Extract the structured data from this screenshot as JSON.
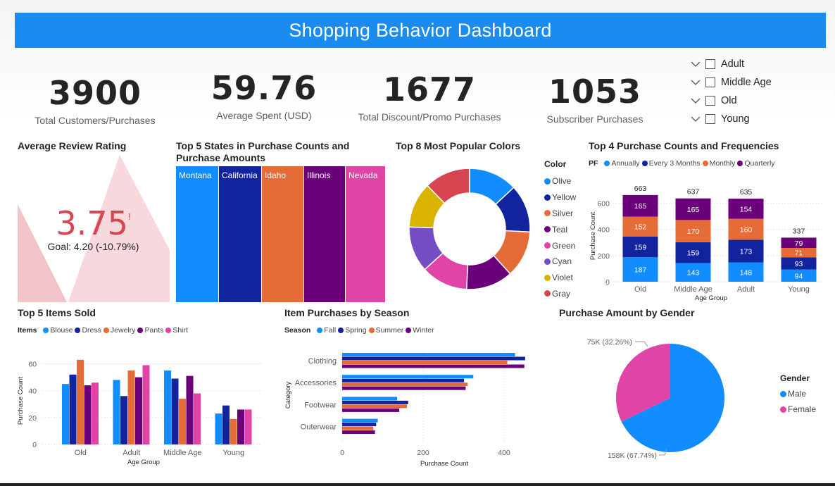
{
  "banner": {
    "title": "Shopping Behavior Dashboard"
  },
  "kpis": [
    {
      "value": "3900",
      "label": "Total Customers/Purchases"
    },
    {
      "value": "59.76",
      "label": "Average Spent (USD)"
    },
    {
      "value": "1677",
      "label": "Total Discount/Promo Purchases"
    },
    {
      "value": "1053",
      "label": "Subscriber Purchases"
    }
  ],
  "slicer": {
    "items": [
      "Adult",
      "Middle Age",
      "Old",
      "Young"
    ]
  },
  "rating": {
    "title": "Average Review Rating",
    "value": "3.75",
    "alert": "!",
    "goal": "Goal: 4.20 (-10.79%)"
  },
  "states": {
    "title_line1": "Top 5 States in Purchase Counts and",
    "title_line2": "Purchase Amounts",
    "items": [
      {
        "name": "Montana",
        "color": "#118dff"
      },
      {
        "name": "California",
        "color": "#12239e"
      },
      {
        "name": "Idaho",
        "color": "#e66c37"
      },
      {
        "name": "Illinois",
        "color": "#6b007b"
      },
      {
        "name": "Nevada",
        "color": "#e044a7"
      }
    ]
  },
  "colors_chart": {
    "title": "Top 8 Most Popular Colors",
    "legend_title": "Color",
    "items": [
      {
        "name": "Olive",
        "color": "#118dff",
        "share": 0.13
      },
      {
        "name": "Yellow",
        "color": "#12239e",
        "share": 0.128
      },
      {
        "name": "Silver",
        "color": "#e66c37",
        "share": 0.125
      },
      {
        "name": "Teal",
        "color": "#6b007b",
        "share": 0.125
      },
      {
        "name": "Green",
        "color": "#e044a7",
        "share": 0.125
      },
      {
        "name": "Cyan",
        "color": "#744ec2",
        "share": 0.122
      },
      {
        "name": "Violet",
        "color": "#d9b300",
        "share": 0.122
      },
      {
        "name": "Gray",
        "color": "#d64550",
        "share": 0.123
      }
    ]
  },
  "freq_chart": {
    "title": "Top 4 Purchase Counts and Frequencies",
    "legend_title": "PF",
    "ylabel": "Purchase Count",
    "xlabel": "Age Group",
    "yticks": [
      "0",
      "200",
      "400",
      "600"
    ]
  },
  "items_chart": {
    "title": "Top 5 Items Sold",
    "legend_title": "Items",
    "ylabel": "Purchase Count",
    "xlabel": "Age Group",
    "yticks": [
      "0",
      "20",
      "40",
      "60"
    ]
  },
  "season_chart": {
    "title": "Item Purchases by Season",
    "legend_title": "Season",
    "ylabel": "Category",
    "xlabel": "Purchase Count",
    "xticks": [
      "0",
      "200",
      "400"
    ]
  },
  "gender_chart": {
    "title": "Purchase Amount by Gender",
    "legend_title": "Gender",
    "items": [
      {
        "name": "Male",
        "color": "#118dff"
      },
      {
        "name": "Female",
        "color": "#e044a7"
      }
    ],
    "label_female": "75K (32.26%)",
    "label_male": "158K (67.74%)"
  },
  "chart_data": [
    {
      "type": "bar",
      "title": "Top 4 Purchase Counts and Frequencies",
      "stacked": true,
      "categories": [
        "Old",
        "Middle Age",
        "Adult",
        "Young"
      ],
      "totals": [
        663,
        637,
        635,
        337
      ],
      "series": [
        {
          "name": "Annually",
          "color": "#118dff",
          "values": [
            187,
            143,
            148,
            94
          ]
        },
        {
          "name": "Every 3 Months",
          "color": "#12239e",
          "values": [
            159,
            159,
            173,
            93
          ]
        },
        {
          "name": "Monthly",
          "color": "#e66c37",
          "values": [
            152,
            170,
            160,
            71
          ]
        },
        {
          "name": "Quarterly",
          "color": "#6b007b",
          "values": [
            165,
            165,
            154,
            79
          ]
        }
      ],
      "xlabel": "Age Group",
      "ylabel": "Purchase Count",
      "ylim": [
        0,
        700
      ]
    },
    {
      "type": "bar",
      "title": "Top 5 Items Sold",
      "categories": [
        "Old",
        "Adult",
        "Middle Age",
        "Young"
      ],
      "series": [
        {
          "name": "Blouse",
          "color": "#118dff",
          "values": [
            45,
            48,
            55,
            23
          ]
        },
        {
          "name": "Dress",
          "color": "#12239e",
          "values": [
            52,
            36,
            49,
            29
          ]
        },
        {
          "name": "Jewelry",
          "color": "#e66c37",
          "values": [
            63,
            55,
            34,
            19
          ]
        },
        {
          "name": "Pants",
          "color": "#6b007b",
          "values": [
            44,
            50,
            51,
            26
          ]
        },
        {
          "name": "Shirt",
          "color": "#e044a7",
          "values": [
            46,
            59,
            38,
            26
          ]
        }
      ],
      "xlabel": "Age Group",
      "ylabel": "Purchase Count",
      "ylim": [
        0,
        65
      ]
    },
    {
      "type": "bar",
      "orientation": "horizontal",
      "title": "Item Purchases by Season",
      "categories": [
        "Clothing",
        "Accessories",
        "Footwear",
        "Outerwear"
      ],
      "series": [
        {
          "name": "Fall",
          "color": "#118dff",
          "values": [
            427,
            324,
            136,
            88
          ]
        },
        {
          "name": "Spring",
          "color": "#12239e",
          "values": [
            452,
            301,
            163,
            84
          ]
        },
        {
          "name": "Summer",
          "color": "#e66c37",
          "values": [
            408,
            310,
            160,
            77
          ]
        },
        {
          "name": "Winter",
          "color": "#6b007b",
          "values": [
            450,
            305,
            141,
            81
          ]
        }
      ],
      "xlabel": "Purchase Count",
      "ylabel": "Category",
      "xlim": [
        0,
        480
      ]
    },
    {
      "type": "pie",
      "title": "Purchase Amount by Gender",
      "labels": [
        "Male",
        "Female"
      ],
      "values": [
        158,
        75
      ],
      "percent": [
        67.74,
        32.26
      ]
    }
  ]
}
